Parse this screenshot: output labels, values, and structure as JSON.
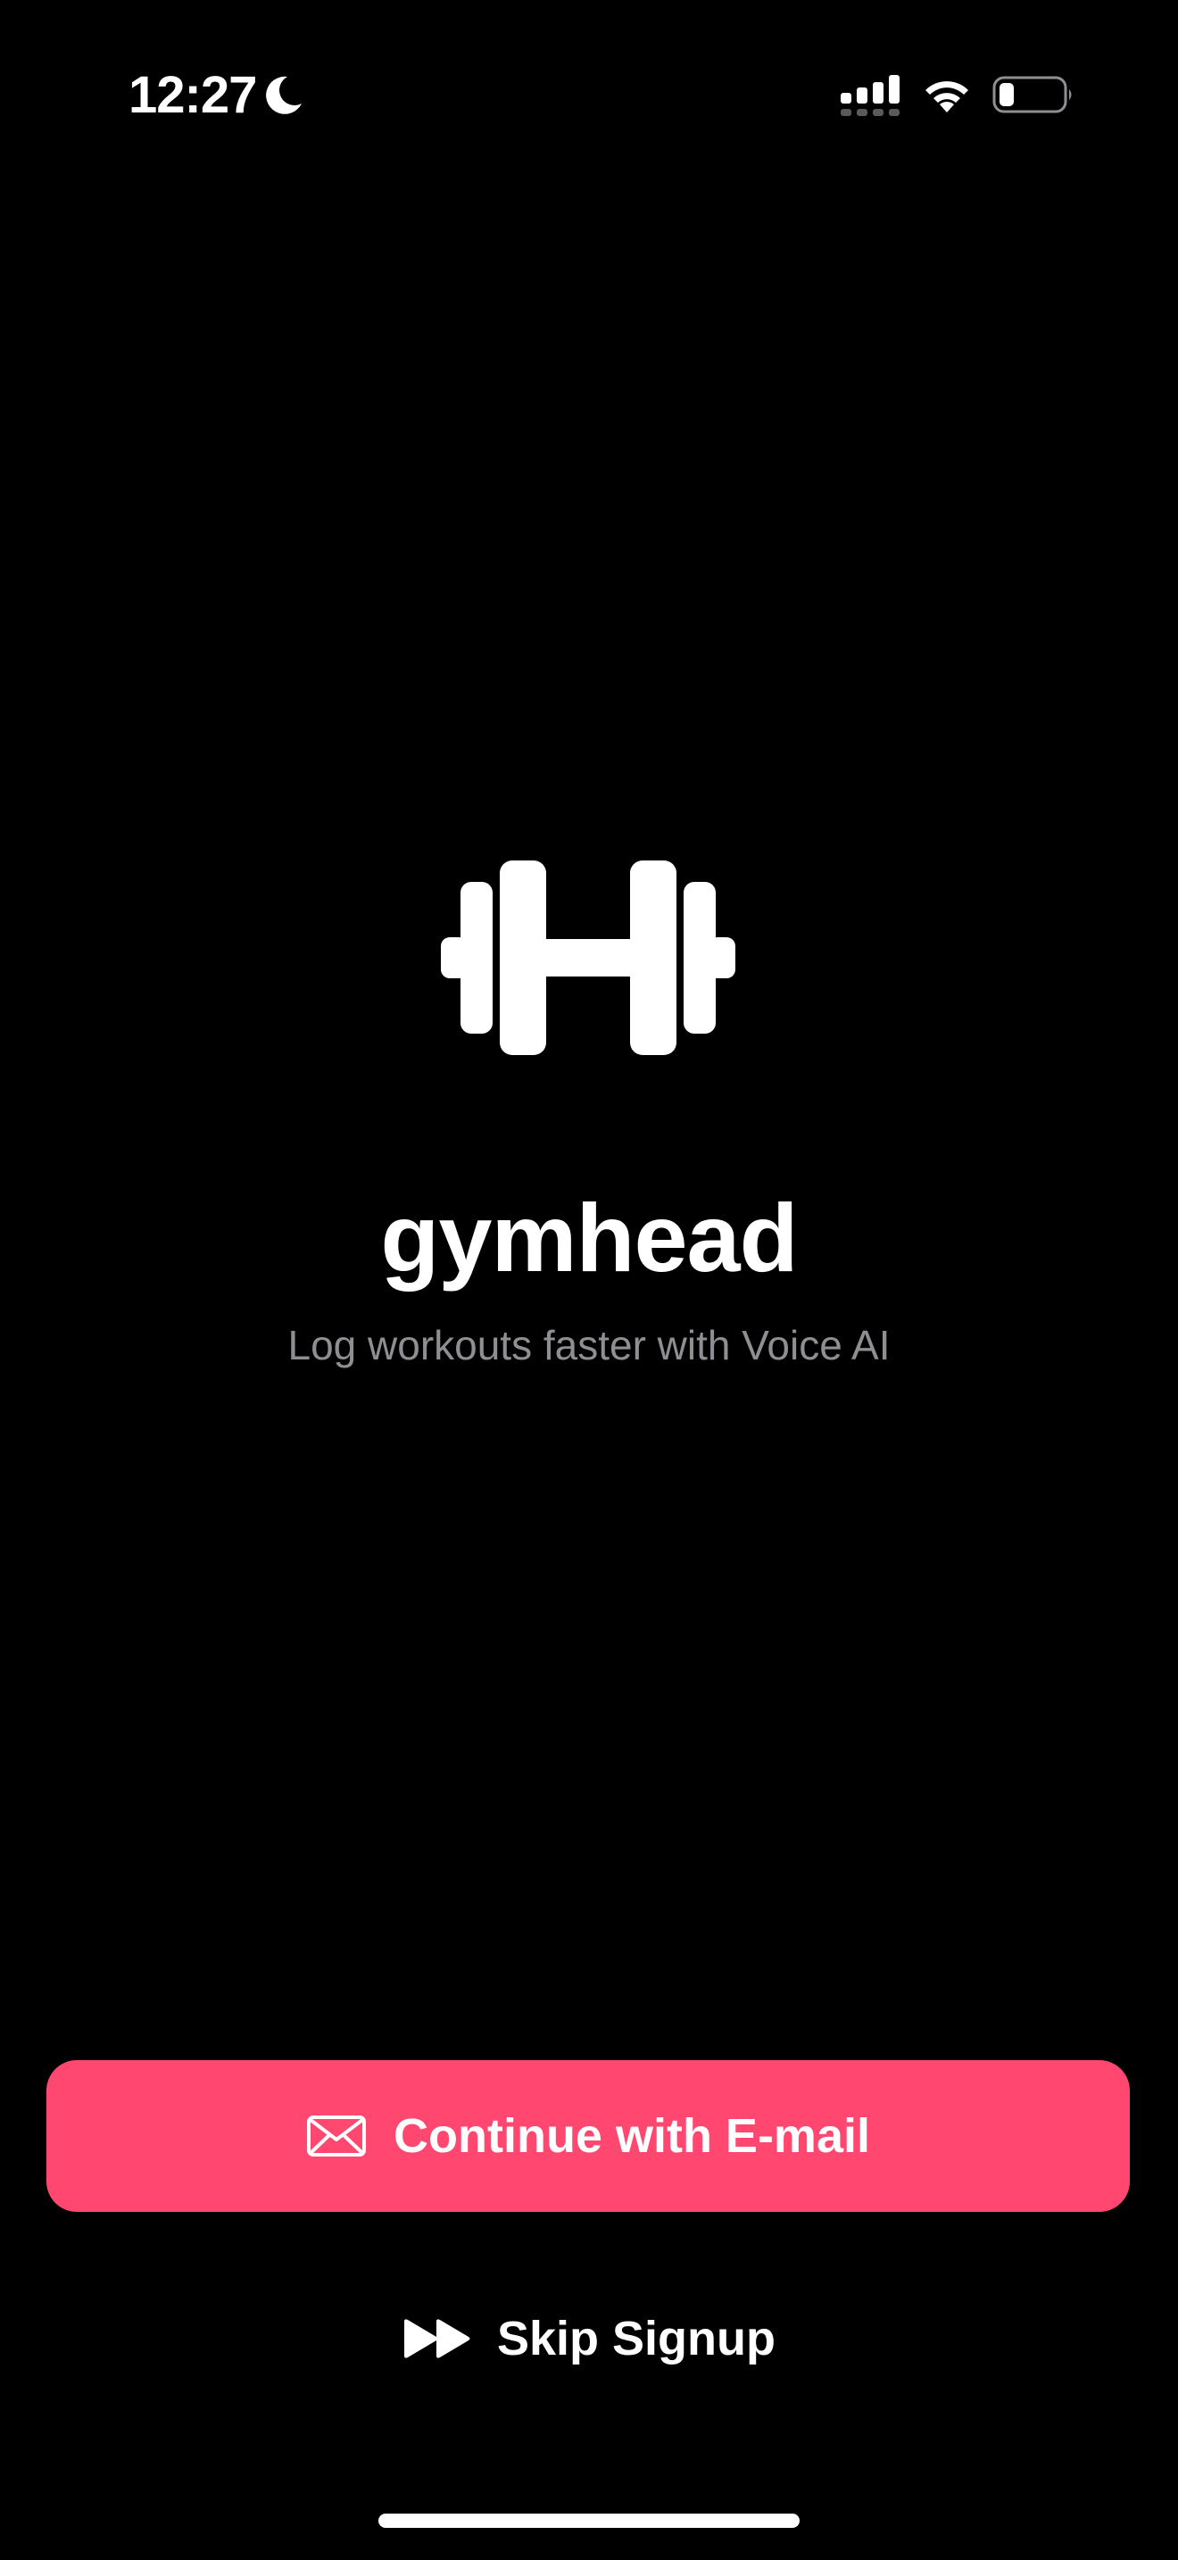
{
  "status_bar": {
    "time": "12:27",
    "icons": [
      "moon-icon",
      "cellular-signal-icon",
      "wifi-icon",
      "battery-icon"
    ]
  },
  "brand": {
    "logo_icon": "dumbbell-icon",
    "app_name": "gymhead",
    "tagline": "Log workouts faster with Voice AI"
  },
  "actions": {
    "email": {
      "icon": "mail-icon",
      "label": "Continue with E-mail"
    },
    "skip": {
      "icon": "fast-forward-icon",
      "label": "Skip Signup"
    }
  },
  "colors": {
    "background": "#000000",
    "accent": "#ff4770",
    "text_primary": "#ffffff",
    "text_secondary": "#8e8e93"
  }
}
